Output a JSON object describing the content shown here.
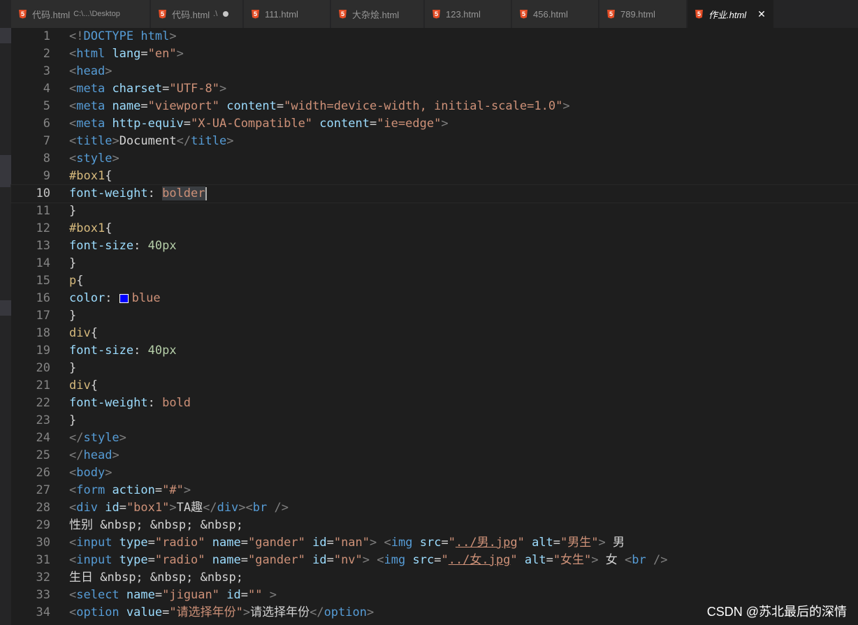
{
  "tabs": [
    {
      "name": "代码.html",
      "path": "C:\\...\\Desktop",
      "active": false,
      "modified": false
    },
    {
      "name": "代码.html",
      "path": ".\\",
      "active": false,
      "modified": true
    },
    {
      "name": "111.html",
      "path": "",
      "active": false,
      "modified": false
    },
    {
      "name": "大杂烩.html",
      "path": "",
      "active": false,
      "modified": false
    },
    {
      "name": "123.html",
      "path": "",
      "active": false,
      "modified": false
    },
    {
      "name": "456.html",
      "path": "",
      "active": false,
      "modified": false
    },
    {
      "name": "789.html",
      "path": "",
      "active": false,
      "modified": false
    },
    {
      "name": "作业.html",
      "path": "",
      "active": true,
      "modified": false
    }
  ],
  "editor": {
    "current_line": 10,
    "lines": [
      {
        "n": "1",
        "t": [
          [
            "<!",
            "punc"
          ],
          [
            "DOCTYPE html",
            "tag"
          ],
          [
            ">",
            "punc"
          ]
        ]
      },
      {
        "n": "2",
        "t": [
          [
            "<",
            "punc"
          ],
          [
            "html",
            "tag"
          ],
          [
            " lang",
            "attr"
          ],
          [
            "=",
            "text"
          ],
          [
            "\"en\"",
            "str"
          ],
          [
            ">",
            "punc"
          ]
        ]
      },
      {
        "n": "3",
        "t": [
          [
            "<",
            "punc"
          ],
          [
            "head",
            "tag"
          ],
          [
            ">",
            "punc"
          ]
        ]
      },
      {
        "n": "4",
        "t": [
          [
            "<",
            "punc"
          ],
          [
            "meta",
            "tag"
          ],
          [
            " charset",
            "attr"
          ],
          [
            "=",
            "text"
          ],
          [
            "\"UTF-8\"",
            "str"
          ],
          [
            ">",
            "punc"
          ]
        ]
      },
      {
        "n": "5",
        "t": [
          [
            "<",
            "punc"
          ],
          [
            "meta",
            "tag"
          ],
          [
            " name",
            "attr"
          ],
          [
            "=",
            "text"
          ],
          [
            "\"viewport\"",
            "str"
          ],
          [
            " content",
            "attr"
          ],
          [
            "=",
            "text"
          ],
          [
            "\"width=device-width, initial-scale=1.0\"",
            "str"
          ],
          [
            ">",
            "punc"
          ]
        ]
      },
      {
        "n": "6",
        "t": [
          [
            "<",
            "punc"
          ],
          [
            "meta",
            "tag"
          ],
          [
            " http-equiv",
            "attr"
          ],
          [
            "=",
            "text"
          ],
          [
            "\"X-UA-Compatible\"",
            "str"
          ],
          [
            " content",
            "attr"
          ],
          [
            "=",
            "text"
          ],
          [
            "\"ie=edge\"",
            "str"
          ],
          [
            ">",
            "punc"
          ]
        ]
      },
      {
        "n": "7",
        "t": [
          [
            "<",
            "punc"
          ],
          [
            "title",
            "tag"
          ],
          [
            ">",
            "punc"
          ],
          [
            "Document",
            "text"
          ],
          [
            "</",
            "punc"
          ],
          [
            "title",
            "tag"
          ],
          [
            ">",
            "punc"
          ]
        ]
      },
      {
        "n": "8",
        "t": [
          [
            "<",
            "punc"
          ],
          [
            "style",
            "tag"
          ],
          [
            ">",
            "punc"
          ]
        ]
      },
      {
        "n": "9",
        "t": [
          [
            "#box1",
            "sel"
          ],
          [
            "{",
            "text"
          ]
        ]
      },
      {
        "n": "10",
        "t": [
          [
            "font-weight",
            "prop"
          ],
          [
            ": ",
            "text"
          ],
          [
            "bolder",
            "valsel"
          ],
          [
            "",
            "caret"
          ]
        ]
      },
      {
        "n": "11",
        "t": [
          [
            "}",
            "text"
          ]
        ]
      },
      {
        "n": "12",
        "t": [
          [
            "#box1",
            "sel"
          ],
          [
            "{",
            "text"
          ]
        ]
      },
      {
        "n": "13",
        "t": [
          [
            "font-size",
            "prop"
          ],
          [
            ": ",
            "text"
          ],
          [
            "40px",
            "num"
          ]
        ]
      },
      {
        "n": "14",
        "t": [
          [
            "}",
            "text"
          ]
        ]
      },
      {
        "n": "15",
        "t": [
          [
            "p",
            "sel"
          ],
          [
            "{",
            "text"
          ]
        ]
      },
      {
        "n": "16",
        "t": [
          [
            "color",
            "prop"
          ],
          [
            ": ",
            "text"
          ],
          [
            "#0000ff",
            "swatch"
          ],
          [
            "blue",
            "val"
          ]
        ]
      },
      {
        "n": "17",
        "t": [
          [
            "}",
            "text"
          ]
        ]
      },
      {
        "n": "18",
        "t": [
          [
            "div",
            "sel"
          ],
          [
            "{",
            "text"
          ]
        ]
      },
      {
        "n": "19",
        "t": [
          [
            "font-size",
            "prop"
          ],
          [
            ": ",
            "text"
          ],
          [
            "40px",
            "num"
          ]
        ]
      },
      {
        "n": "20",
        "t": [
          [
            "}",
            "text"
          ]
        ]
      },
      {
        "n": "21",
        "t": [
          [
            "div",
            "sel"
          ],
          [
            "{",
            "text"
          ]
        ]
      },
      {
        "n": "22",
        "t": [
          [
            "font-weight",
            "prop"
          ],
          [
            ": ",
            "text"
          ],
          [
            "bold",
            "val"
          ]
        ]
      },
      {
        "n": "23",
        "t": [
          [
            "}",
            "text"
          ]
        ]
      },
      {
        "n": "24",
        "t": [
          [
            "</",
            "punc"
          ],
          [
            "style",
            "tag"
          ],
          [
            ">",
            "punc"
          ]
        ]
      },
      {
        "n": "25",
        "t": [
          [
            "</",
            "punc"
          ],
          [
            "head",
            "tag"
          ],
          [
            ">",
            "punc"
          ]
        ]
      },
      {
        "n": "26",
        "t": [
          [
            "<",
            "punc"
          ],
          [
            "body",
            "tag"
          ],
          [
            ">",
            "punc"
          ]
        ]
      },
      {
        "n": "27",
        "t": [
          [
            "<",
            "punc"
          ],
          [
            "form",
            "tag"
          ],
          [
            " action",
            "attr"
          ],
          [
            "=",
            "text"
          ],
          [
            "\"#\"",
            "str"
          ],
          [
            ">",
            "punc"
          ]
        ]
      },
      {
        "n": "28",
        "t": [
          [
            "<",
            "punc"
          ],
          [
            "div",
            "tag"
          ],
          [
            " id",
            "attr"
          ],
          [
            "=",
            "text"
          ],
          [
            "\"box1\"",
            "str"
          ],
          [
            ">",
            "punc"
          ],
          [
            "TA趣",
            "text"
          ],
          [
            "</",
            "punc"
          ],
          [
            "div",
            "tag"
          ],
          [
            "><",
            "punc"
          ],
          [
            "br",
            "tag"
          ],
          [
            " />",
            "punc"
          ]
        ]
      },
      {
        "n": "29",
        "t": [
          [
            "性别 ",
            "text"
          ],
          [
            "&nbsp;",
            "ent"
          ],
          [
            " ",
            "text"
          ],
          [
            "&nbsp;",
            "ent"
          ],
          [
            " ",
            "text"
          ],
          [
            "&nbsp;",
            "ent"
          ]
        ]
      },
      {
        "n": "30",
        "t": [
          [
            "<",
            "punc"
          ],
          [
            "input",
            "tag"
          ],
          [
            " type",
            "attr"
          ],
          [
            "=",
            "text"
          ],
          [
            "\"radio\"",
            "str"
          ],
          [
            " name",
            "attr"
          ],
          [
            "=",
            "text"
          ],
          [
            "\"gander\"",
            "str"
          ],
          [
            " id",
            "attr"
          ],
          [
            "=",
            "text"
          ],
          [
            "\"nan\"",
            "str"
          ],
          [
            ">",
            "punc"
          ],
          [
            " ",
            "text"
          ],
          [
            "<",
            "punc"
          ],
          [
            "img",
            "tag"
          ],
          [
            " src",
            "attr"
          ],
          [
            "=",
            "text"
          ],
          [
            "\"",
            "str"
          ],
          [
            "../男.jpg",
            "link"
          ],
          [
            "\"",
            "str"
          ],
          [
            " alt",
            "attr"
          ],
          [
            "=",
            "text"
          ],
          [
            "\"男生\"",
            "str"
          ],
          [
            ">",
            "punc"
          ],
          [
            " 男",
            "text"
          ]
        ]
      },
      {
        "n": "31",
        "t": [
          [
            "<",
            "punc"
          ],
          [
            "input",
            "tag"
          ],
          [
            " type",
            "attr"
          ],
          [
            "=",
            "text"
          ],
          [
            "\"radio\"",
            "str"
          ],
          [
            " name",
            "attr"
          ],
          [
            "=",
            "text"
          ],
          [
            "\"gander\"",
            "str"
          ],
          [
            " id",
            "attr"
          ],
          [
            "=",
            "text"
          ],
          [
            "\"nv\"",
            "str"
          ],
          [
            ">",
            "punc"
          ],
          [
            " ",
            "text"
          ],
          [
            "<",
            "punc"
          ],
          [
            "img",
            "tag"
          ],
          [
            " src",
            "attr"
          ],
          [
            "=",
            "text"
          ],
          [
            "\"",
            "str"
          ],
          [
            "../女.jpg",
            "link"
          ],
          [
            "\"",
            "str"
          ],
          [
            " alt",
            "attr"
          ],
          [
            "=",
            "text"
          ],
          [
            "\"女生\"",
            "str"
          ],
          [
            ">",
            "punc"
          ],
          [
            " 女 ",
            "text"
          ],
          [
            "<",
            "punc"
          ],
          [
            "br",
            "tag"
          ],
          [
            " />",
            "punc"
          ]
        ]
      },
      {
        "n": "32",
        "t": [
          [
            "生日 ",
            "text"
          ],
          [
            "&nbsp;",
            "ent"
          ],
          [
            " ",
            "text"
          ],
          [
            "&nbsp;",
            "ent"
          ],
          [
            " ",
            "text"
          ],
          [
            "&nbsp;",
            "ent"
          ]
        ]
      },
      {
        "n": "33",
        "t": [
          [
            "<",
            "punc"
          ],
          [
            "select",
            "tag"
          ],
          [
            " name",
            "attr"
          ],
          [
            "=",
            "text"
          ],
          [
            "\"jiguan\"",
            "str"
          ],
          [
            " id",
            "attr"
          ],
          [
            "=",
            "text"
          ],
          [
            "\"\"",
            "str"
          ],
          [
            " >",
            "punc"
          ]
        ]
      },
      {
        "n": "34",
        "t": [
          [
            "<",
            "punc"
          ],
          [
            "option",
            "tag"
          ],
          [
            " value",
            "attr"
          ],
          [
            "=",
            "text"
          ],
          [
            "\"请选择年份\"",
            "str"
          ],
          [
            ">",
            "punc"
          ],
          [
            "请选择年份",
            "text"
          ],
          [
            "</",
            "punc"
          ],
          [
            "option",
            "tag"
          ],
          [
            ">",
            "punc"
          ]
        ]
      }
    ]
  },
  "watermark": "CSDN @苏北最后的深情",
  "colors": {
    "background": "#1e1e1e",
    "tab_bar": "#252526",
    "tab_inactive": "#2d2d2d",
    "html_icon": "#e44d26",
    "swatch_blue": "#0000ff"
  }
}
